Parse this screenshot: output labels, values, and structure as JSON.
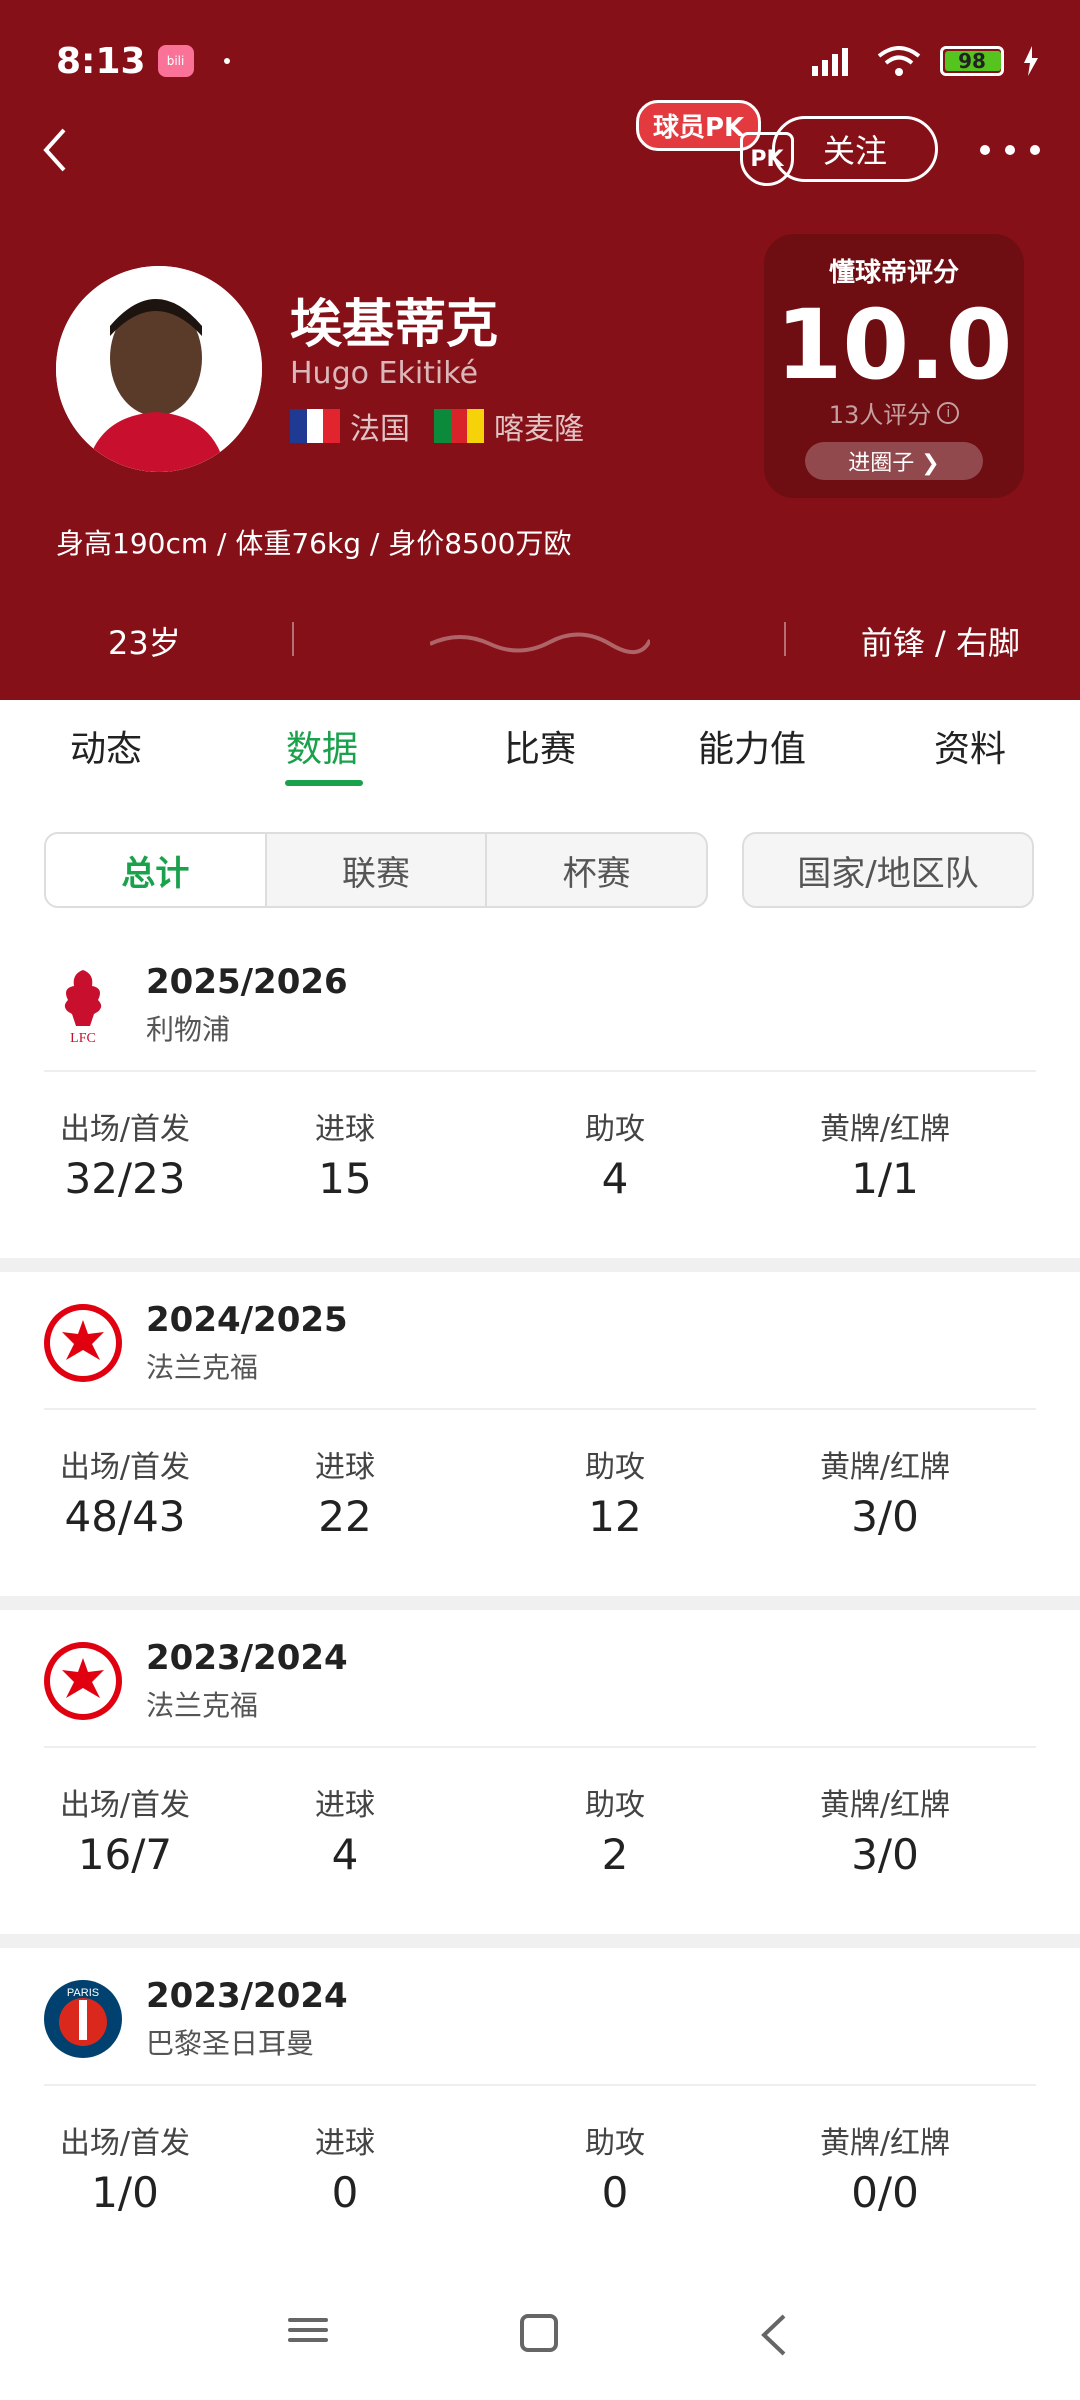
{
  "status_bar": {
    "time": "8:13",
    "battery": "98",
    "app_badge": "bilibili"
  },
  "header": {
    "pk_label": "球员PK",
    "pk_badge": "PK",
    "follow_label": "关注",
    "player": {
      "name": "埃基蒂克",
      "english_name": "Hugo Ekitiké",
      "nationalities": [
        "法国",
        "喀麦隆"
      ],
      "bio": "身高190cm / 体重76kg / 身价8500万欧",
      "age": "23岁",
      "position": "前锋 / 右脚"
    },
    "rating": {
      "title": "懂球帝评分",
      "score": "10.0",
      "count": "13人评分",
      "circle_button": "进圈子 ❯"
    }
  },
  "tabs": [
    "动态",
    "数据",
    "比赛",
    "能力值",
    "资料"
  ],
  "active_tab": "数据",
  "filters": {
    "segments": [
      "总计",
      "联赛",
      "杯赛"
    ],
    "active": "总计",
    "country_button": "国家/地区队"
  },
  "stat_labels": {
    "apps": "出场/首发",
    "goals": "进球",
    "assists": "助攻",
    "cards": "黄牌/红牌"
  },
  "seasons": [
    {
      "year": "2025/2026",
      "club": "利物浦",
      "logo": "liverpool",
      "apps": "32/23",
      "goals": "15",
      "assists": "4",
      "cards": "1/1"
    },
    {
      "year": "2024/2025",
      "club": "法兰克福",
      "logo": "frankfurt",
      "apps": "48/43",
      "goals": "22",
      "assists": "12",
      "cards": "3/0"
    },
    {
      "year": "2023/2024",
      "club": "法兰克福",
      "logo": "frankfurt",
      "apps": "16/7",
      "goals": "4",
      "assists": "2",
      "cards": "3/0"
    },
    {
      "year": "2023/2024",
      "club": "巴黎圣日耳曼",
      "logo": "psg",
      "apps": "1/0",
      "goals": "0",
      "assists": "0",
      "cards": "0/0"
    }
  ],
  "colors": {
    "header_bg": "#851017",
    "accent_green": "#1aa14b",
    "rating_bg": "#6e0d12"
  }
}
